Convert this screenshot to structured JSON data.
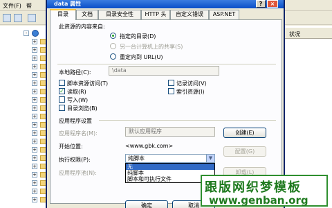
{
  "background_window": {
    "menu": [
      "文件(F)",
      "帮"
    ],
    "right_column_header": "状况"
  },
  "dialog": {
    "title": "data 属性",
    "help_label": "?",
    "close_label": "×",
    "tabs": [
      "目录",
      "文档",
      "目录安全性",
      "HTTP 头",
      "自定义错误",
      "ASP.NET"
    ],
    "content_source": {
      "heading": "此资源的内容来自:",
      "options": [
        {
          "label": "指定的目录(D)",
          "selected": true,
          "enabled": true
        },
        {
          "label": "另一台计算机上的共享(S)",
          "selected": false,
          "enabled": false
        },
        {
          "label": "重定向到 URL(U)",
          "selected": false,
          "enabled": true
        }
      ]
    },
    "local_path": {
      "label": "本地路径(C):",
      "value": "\\data"
    },
    "checkboxes_left": [
      {
        "label": "脚本资源访问(T)",
        "checked": false
      },
      {
        "label": "读取(R)",
        "checked": true
      },
      {
        "label": "写入(W)",
        "checked": false
      },
      {
        "label": "目录浏览(B)",
        "checked": false
      }
    ],
    "checkboxes_right": [
      {
        "label": "记录访问(V)",
        "checked": false
      },
      {
        "label": "索引资源(I)",
        "checked": false
      }
    ],
    "app_settings": {
      "heading": "应用程序设置",
      "app_name_label": "应用程序名(M):",
      "app_name_value": "默认应用程序",
      "create_button": "创建(E)",
      "start_point_label": "开始位置:",
      "start_point_value": "<www.gbk.com>",
      "config_button": "配置(G)",
      "exec_perm_label": "执行权限(P):",
      "exec_perm_value": "纯脚本",
      "exec_options": [
        "无",
        "纯脚本",
        "脚本和可执行文件"
      ],
      "app_pool_label": "应用程序池(N):",
      "unload_button": "卸载(L)"
    },
    "footer": {
      "ok": "确定",
      "cancel": "取消"
    }
  },
  "watermark": {
    "text": "跟版网织梦模板",
    "url": "www.genban.org"
  },
  "colors": {
    "titlebar": "#0a4fc8",
    "active_tab_accent": "#ffc83c",
    "selection": "#316ac5",
    "watermark_green": "#1f7a1f"
  }
}
